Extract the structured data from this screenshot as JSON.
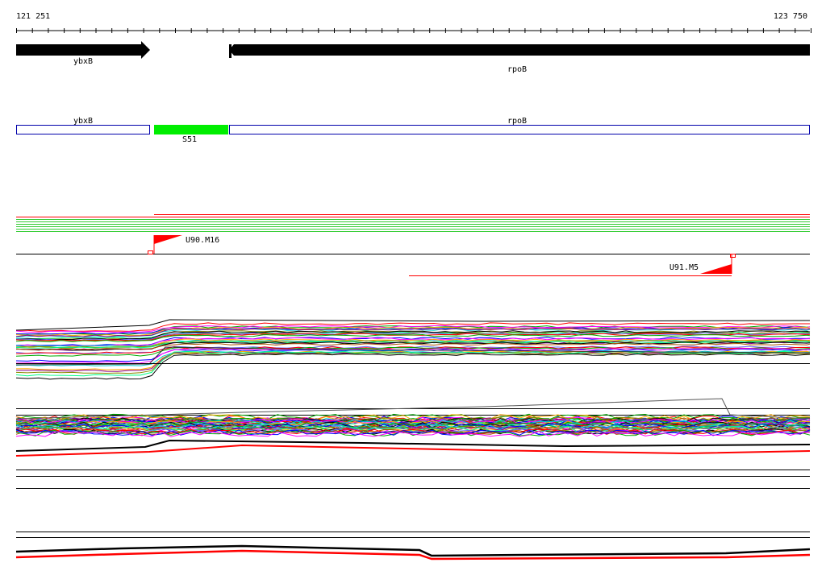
{
  "ruler": {
    "start_label": "121 251",
    "end_label": "123 750"
  },
  "genes": [
    {
      "name": "ybxB",
      "strand": "+"
    },
    {
      "name": "rpoB",
      "strand": "-"
    }
  ],
  "features": [
    {
      "name": "ybxB",
      "kind": "gene-box"
    },
    {
      "name": "S51",
      "kind": "segment"
    },
    {
      "name": "rpoB",
      "kind": "gene-box"
    }
  ],
  "promoters": [
    {
      "name": "U90.M16",
      "direction": "forward"
    },
    {
      "name": "U91.M5",
      "direction": "reverse"
    }
  ],
  "colors": {
    "gene_arrow": "#000000",
    "gene_box_outline": "#0000aa",
    "segment_fill": "#00ee00",
    "promoter": "#ff0000",
    "transcript_lines_green": "#33cc33",
    "transcript_lines_red": "#ff0000",
    "expression_palette": [
      "#ff0000",
      "#00aa00",
      "#0000ff",
      "#ff00ff",
      "#00cccc",
      "#ffaa00",
      "#880088",
      "#888800",
      "#00ff88",
      "#000000",
      "#aa5500",
      "#6666ff"
    ]
  },
  "icons": {
    "promoter_marker": "flag-triangle-icon",
    "gene_arrow": "arrow-icon"
  }
}
